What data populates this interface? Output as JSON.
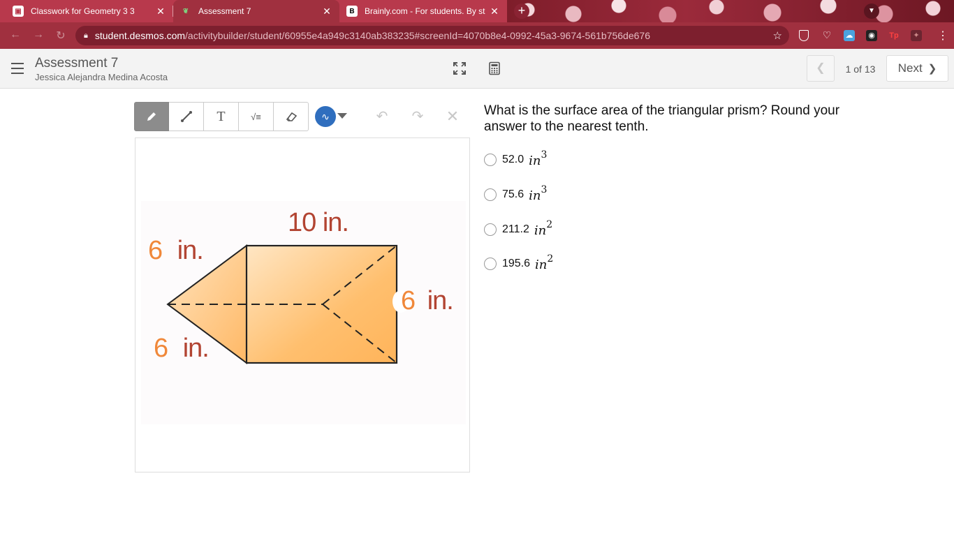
{
  "browser": {
    "tabs": [
      {
        "title": "Classwork for Geometry 3 3",
        "favicon": "classroom-icon",
        "color": "#ffffff"
      },
      {
        "title": "Assessment 7",
        "favicon": "desmos-icon",
        "color": "#2e7d32"
      },
      {
        "title": "Brainly.com - For students. By st",
        "favicon": "brainly-icon",
        "color": "#000000"
      }
    ],
    "close_glyph": "✕",
    "new_tab_glyph": "+",
    "url_host": "student.desmos.com",
    "url_path": "/activitybuilder/student/60955e4a949c3140ab383235#screenId=4070b8e4-0992-45a3-9674-561b756de676",
    "accent": "#a0303f"
  },
  "header": {
    "activity_title": "Assessment 7",
    "student_name": "Jessica Alejandra Medina Acosta",
    "page_indicator": "1 of 13",
    "next_label": "Next"
  },
  "sketch": {
    "tools": [
      "pencil-icon",
      "line-icon",
      "text-icon",
      "math-icon",
      "eraser-icon"
    ],
    "text_tool_glyph": "T",
    "math_tool_glyph": "√≡",
    "active_tool": "pencil-icon",
    "pen_color": "#2f6ebe"
  },
  "figure": {
    "top_label_num": "10",
    "top_label_unit": "in.",
    "left_upper_num": "6",
    "left_upper_unit": "in.",
    "left_lower_num": "6",
    "left_lower_unit": "in.",
    "right_num": "6",
    "right_unit": "in.",
    "fill_color": "#ffb862"
  },
  "question": {
    "prompt": "What is the surface area of the triangular prism? Round your answer to the nearest tenth.",
    "choices": [
      {
        "value": "52.0",
        "unit": "in",
        "exponent": "3"
      },
      {
        "value": "75.6",
        "unit": "in",
        "exponent": "3"
      },
      {
        "value": "211.2",
        "unit": "in",
        "exponent": "2"
      },
      {
        "value": "195.6",
        "unit": "in",
        "exponent": "2"
      }
    ]
  }
}
